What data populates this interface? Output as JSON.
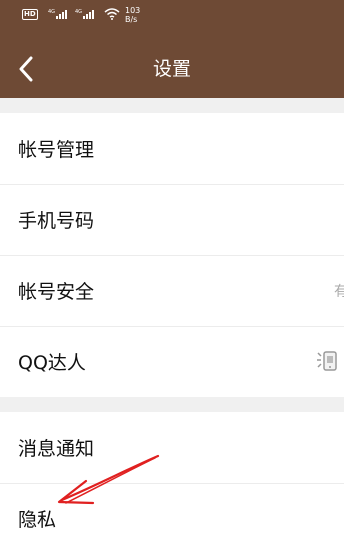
{
  "status_bar": {
    "hd_label": "HD",
    "net_speed_value": "103",
    "net_speed_unit": "B/s",
    "network_1": "4G",
    "network_2": "4G"
  },
  "header": {
    "title": "设置"
  },
  "group1": {
    "items": [
      {
        "label": "帐号管理"
      },
      {
        "label": "手机号码"
      },
      {
        "label": "帐号安全",
        "right": "有"
      },
      {
        "label": "QQ达人"
      }
    ]
  },
  "group2": {
    "items": [
      {
        "label": "消息通知"
      },
      {
        "label": "隐私"
      }
    ]
  },
  "colors": {
    "header_bg": "#6e4a35",
    "annotation_arrow": "#e02020"
  }
}
